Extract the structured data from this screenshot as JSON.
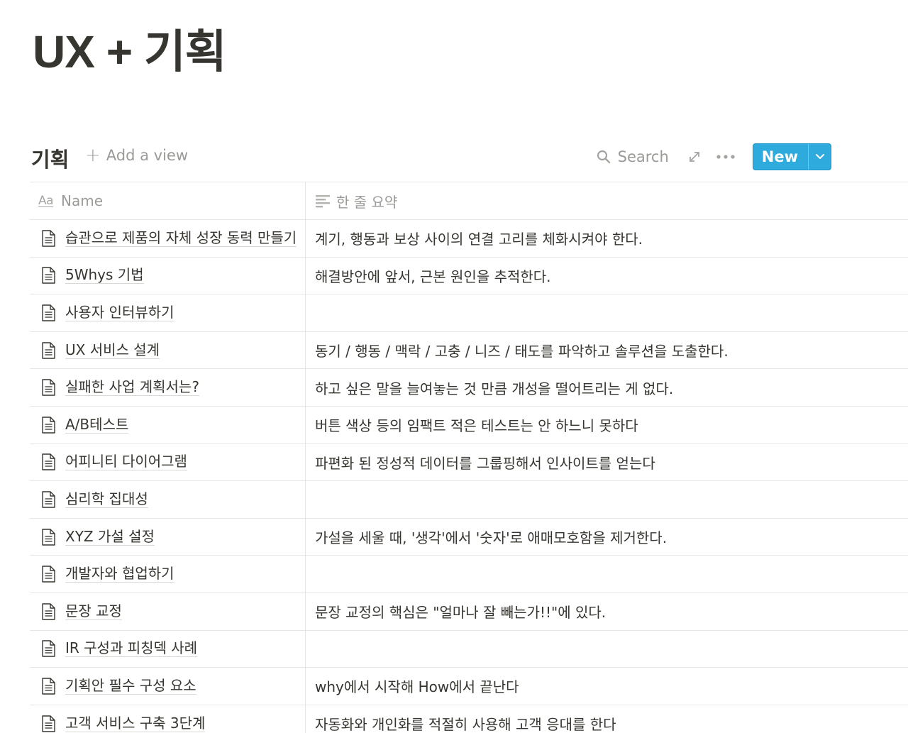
{
  "page": {
    "title": "UX + 기획"
  },
  "database": {
    "title": "기획",
    "add_view_label": "Add a view",
    "search_label": "Search",
    "new_label": "New",
    "accent_color": "#2eaadc"
  },
  "columns": {
    "name": "Name",
    "summary": "한 줄 요약"
  },
  "rows": [
    {
      "name": "습관으로 제품의 자체 성장 동력 만들기",
      "summary": "계기, 행동과 보상 사이의 연결 고리를 체화시켜야 한다."
    },
    {
      "name": "5Whys 기법",
      "summary": "해결방안에 앞서, 근본 원인을 추적한다."
    },
    {
      "name": "사용자 인터뷰하기",
      "summary": ""
    },
    {
      "name": "UX 서비스 설계",
      "summary": "동기 / 행동 / 맥락 / 고충 / 니즈 / 태도를 파악하고 솔루션을 도출한다."
    },
    {
      "name": "실패한 사업 계획서는?",
      "summary": "하고 싶은 말을 늘여놓는 것 만큼 개성을 떨어트리는 게 없다."
    },
    {
      "name": "A/B테스트",
      "summary": "버튼 색상 등의 임팩트 적은 테스트는 안 하느니 못하다"
    },
    {
      "name": "어피니티 다이어그램",
      "summary": "파편화 된 정성적 데이터를 그룹핑해서 인사이트를 얻는다"
    },
    {
      "name": "심리학 집대성",
      "summary": ""
    },
    {
      "name": "XYZ 가설 설정",
      "summary": "가설을 세울 때, '생각'에서 '숫자'로 애매모호함을 제거한다."
    },
    {
      "name": "개발자와 협업하기",
      "summary": ""
    },
    {
      "name": "문장 교정",
      "summary": "문장 교정의 핵심은 \"얼마나 잘 빼는가!!\"에 있다."
    },
    {
      "name": "IR 구성과 피칭덱 사례",
      "summary": ""
    },
    {
      "name": "기획안 필수 구성 요소",
      "summary": "why에서 시작해 How에서 끝난다"
    },
    {
      "name": "고객 서비스 구축 3단계",
      "summary": "자동화와 개인화를 적절히 사용해 고객 응대를 한다"
    }
  ]
}
